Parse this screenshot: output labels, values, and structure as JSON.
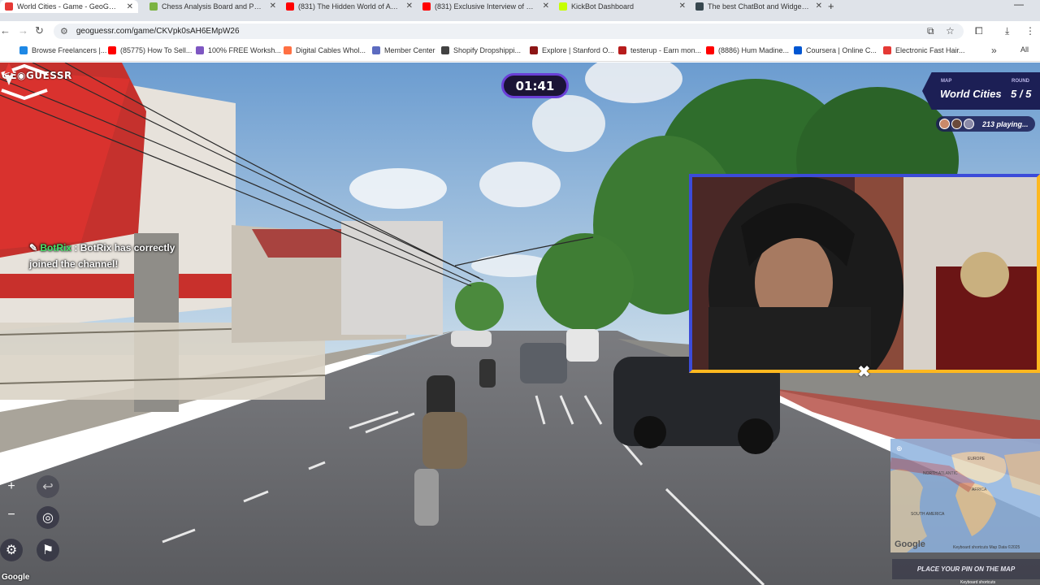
{
  "browser": {
    "tabs": [
      {
        "title": "World Cities - Game - GeoGue...",
        "fav_color": "#e53935",
        "active": true
      },
      {
        "title": "Chess Analysis Board and PGN ...",
        "fav_color": "#7cb342"
      },
      {
        "title": "(831) The Hidden World of Ang...",
        "fav_color": "#ff0000"
      },
      {
        "title": "(831) Exclusive Interview of Dr...",
        "fav_color": "#ff0000"
      },
      {
        "title": "KickBot Dashboard",
        "fav_color": "#c6ff00"
      },
      {
        "title": "The best ChatBot and Widgets...",
        "fav_color": "#37474f"
      }
    ],
    "new_tab": "+",
    "url": "geoguessr.com/game/CKVpk0sAH6EMpW26",
    "bookmarks": [
      {
        "label": "Browse Freelancers |...",
        "color": "#1e88e5"
      },
      {
        "label": "(85775) How To Sell...",
        "color": "#ff0000"
      },
      {
        "label": "100% FREE Worksh...",
        "color": "#7e57c2"
      },
      {
        "label": "Digital Cables Whol...",
        "color": "#ff7043"
      },
      {
        "label": "Member Center",
        "color": "#5c6bc0"
      },
      {
        "label": "Shopify Dropshippi...",
        "color": "#424242"
      },
      {
        "label": "Explore | Stanford O...",
        "color": "#8c1515"
      },
      {
        "label": "testerup - Earn mon...",
        "color": "#b71c1c"
      },
      {
        "label": "(8886) Hum Madine...",
        "color": "#ff0000"
      },
      {
        "label": "Coursera | Online C...",
        "color": "#0056d2"
      },
      {
        "label": "Electronic Fast Hair...",
        "color": "#e53935"
      }
    ],
    "bookmarks_more": "»",
    "bookmarks_all": "All"
  },
  "game": {
    "logo": "GE◉GUESSR",
    "timer": "01:41",
    "map_label": "MAP",
    "map_name": "World Cities",
    "round_label": "ROUND",
    "round_value": "5 / 5",
    "players_text": "213 playing...",
    "chat_user": "BotRix",
    "chat_text": " : BotRix has correctly joined the channel!",
    "place_pin": "PLACE YOUR PIN ON THE MAP",
    "google": "Google",
    "keyboard": "Keyboard shortcuts",
    "map_data": "Map Data ©2025",
    "minimap_labels": [
      "EUROPE",
      "AFRICA",
      "SOUTH AMERICA",
      "NORTH ATLANTIC"
    ],
    "minimap_google": "Google",
    "minimap_footer": "Keyboard shortcuts   Map Data ©2025"
  },
  "colors": {
    "accent_purple": "#6a3fd6",
    "panel_navy": "#1c1f55",
    "chat_green": "#49e36c",
    "webcam_border": "#ffb81f"
  }
}
